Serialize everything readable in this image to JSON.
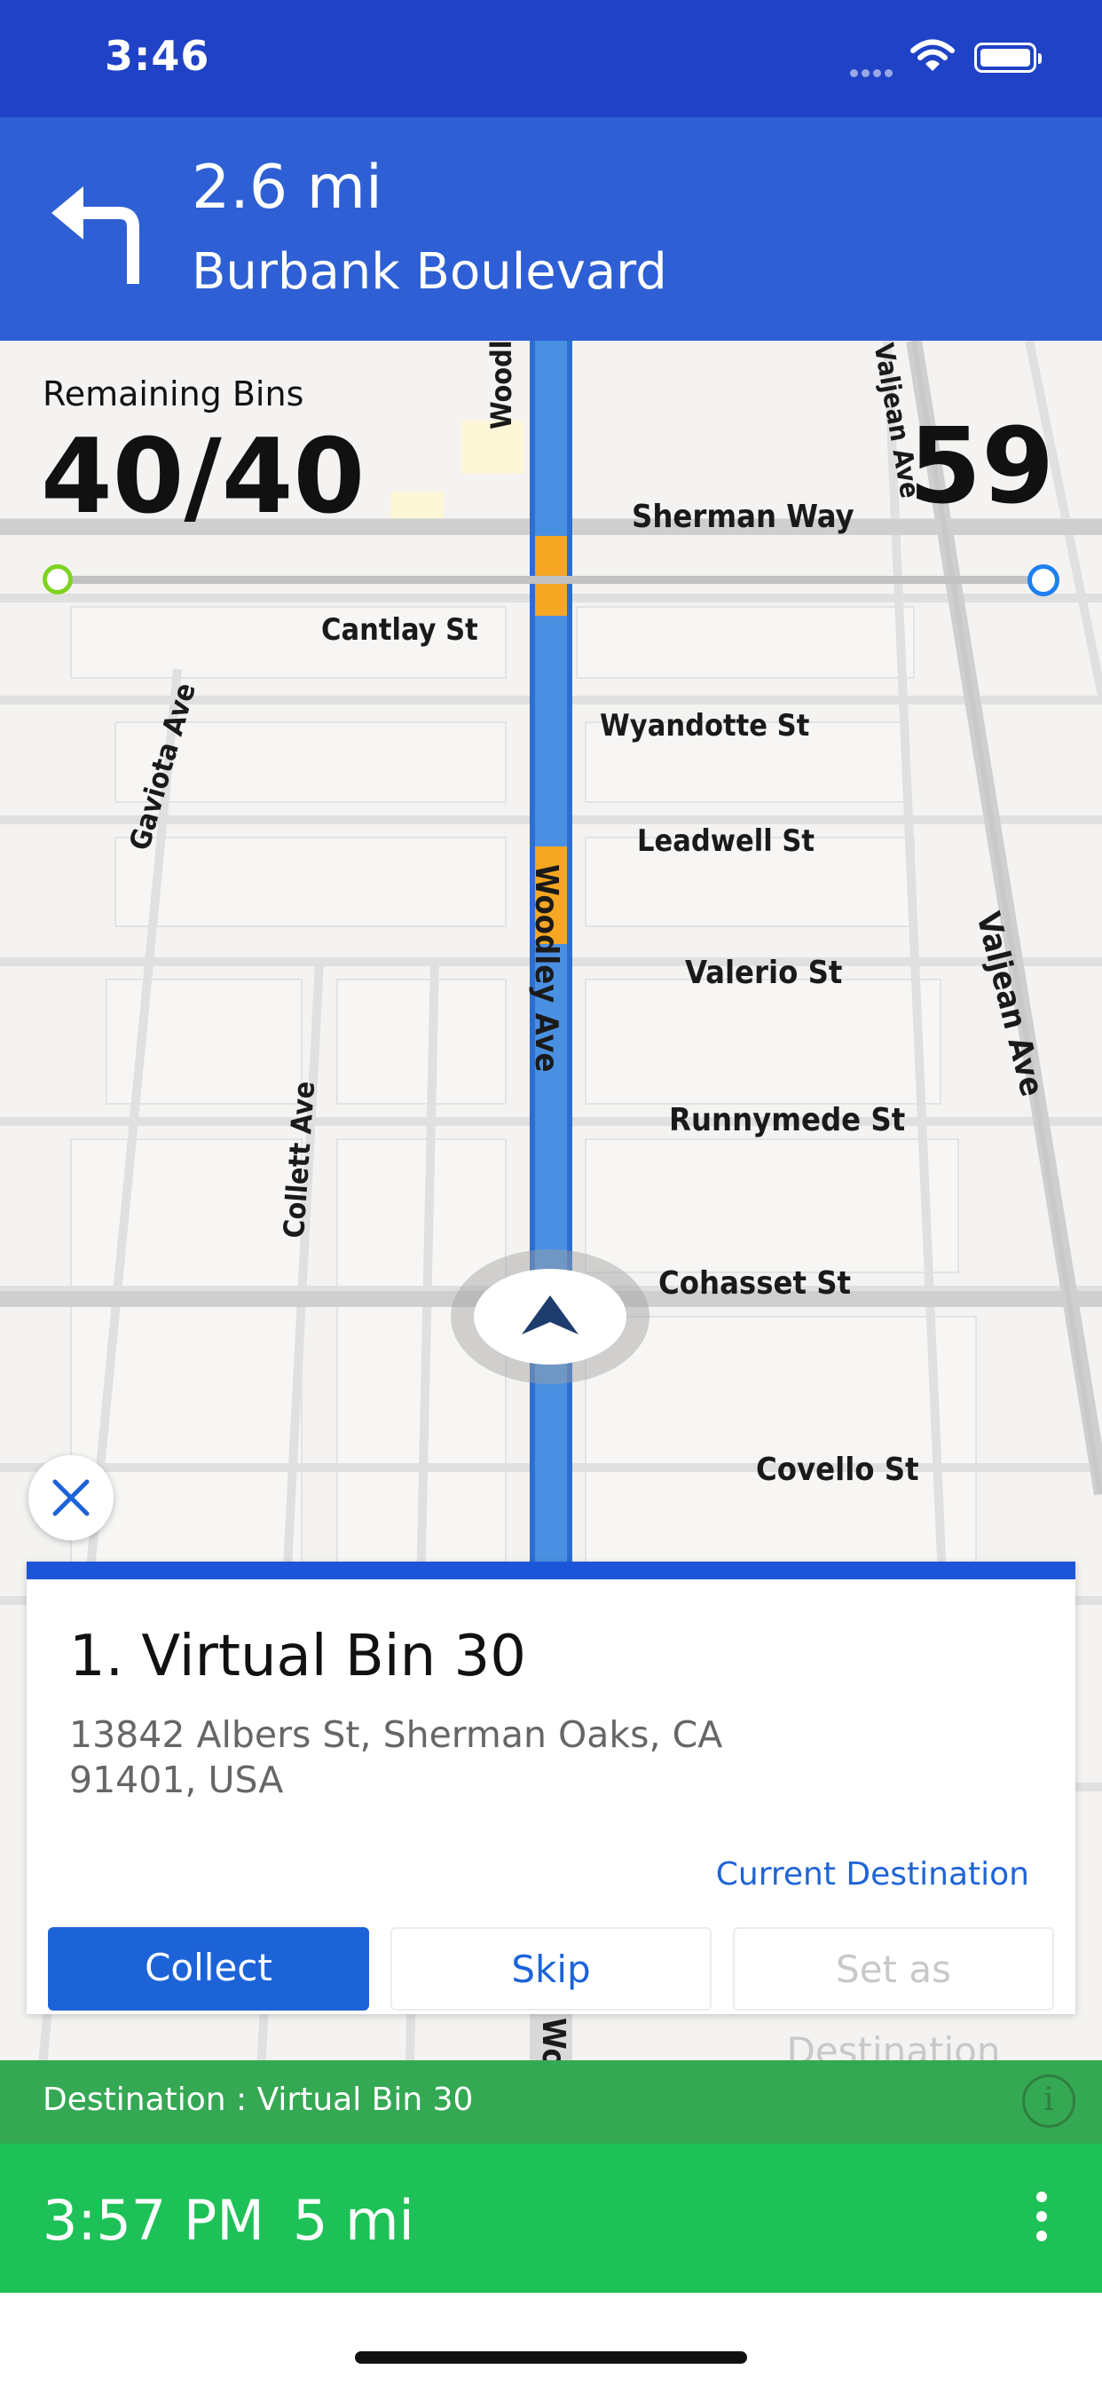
{
  "status_bar": {
    "time": "3:46",
    "icons": [
      "signal-icon",
      "wifi-icon",
      "battery-icon"
    ]
  },
  "navigation": {
    "distance": "2.6 mi",
    "street": "Burbank Boulevard",
    "maneuver_icon": "turn-left-icon"
  },
  "map": {
    "street_labels": {
      "woodley_ave_top": "Woodley Ave",
      "woodley_ave_mid": "Woodley Ave",
      "woodley_ave_bottom": "Woodley Ave",
      "valjean_ave_top": "Valjean Ave",
      "valjean_ave_right": "Valjean Ave",
      "sherman_way": "Sherman Way",
      "cantlay_st": "Cantlay St",
      "gaviota_ave": "Gaviota Ave",
      "wyandotte_st": "Wyandotte St",
      "leadwell_st": "Leadwell St",
      "valerio_st": "Valerio St",
      "runnymede_st": "Runnymede St",
      "collett_ave": "Collett Ave",
      "cohasset_st": "Cohasset St",
      "covello_st": "Covello St"
    },
    "route_color": "#4a90e2",
    "traffic_color": "#f5a623"
  },
  "overlay": {
    "remaining_bins_label": "Remaining Bins",
    "remaining_bins_value": "40/40",
    "speed_value": "59",
    "progress_fraction": 0.0
  },
  "bin_card": {
    "title": "1. Virtual Bin 30",
    "address": "13842 Albers St, Sherman Oaks, CA 91401, USA",
    "status": "Current Destination",
    "buttons": {
      "collect": "Collect",
      "skip": "Skip",
      "set_destination": "Set as Destination"
    }
  },
  "destination_bar": {
    "text": "Destination : Virtual Bin 30",
    "info_glyph": "i"
  },
  "eta_bar": {
    "time": "3:57 PM",
    "distance": "5 mi"
  },
  "colors": {
    "status_bar": "#1f42c6",
    "banner": "#2e5fd4",
    "accent": "#1d63d8",
    "eta_green": "#1ec157",
    "destination_green": "#35a853"
  }
}
